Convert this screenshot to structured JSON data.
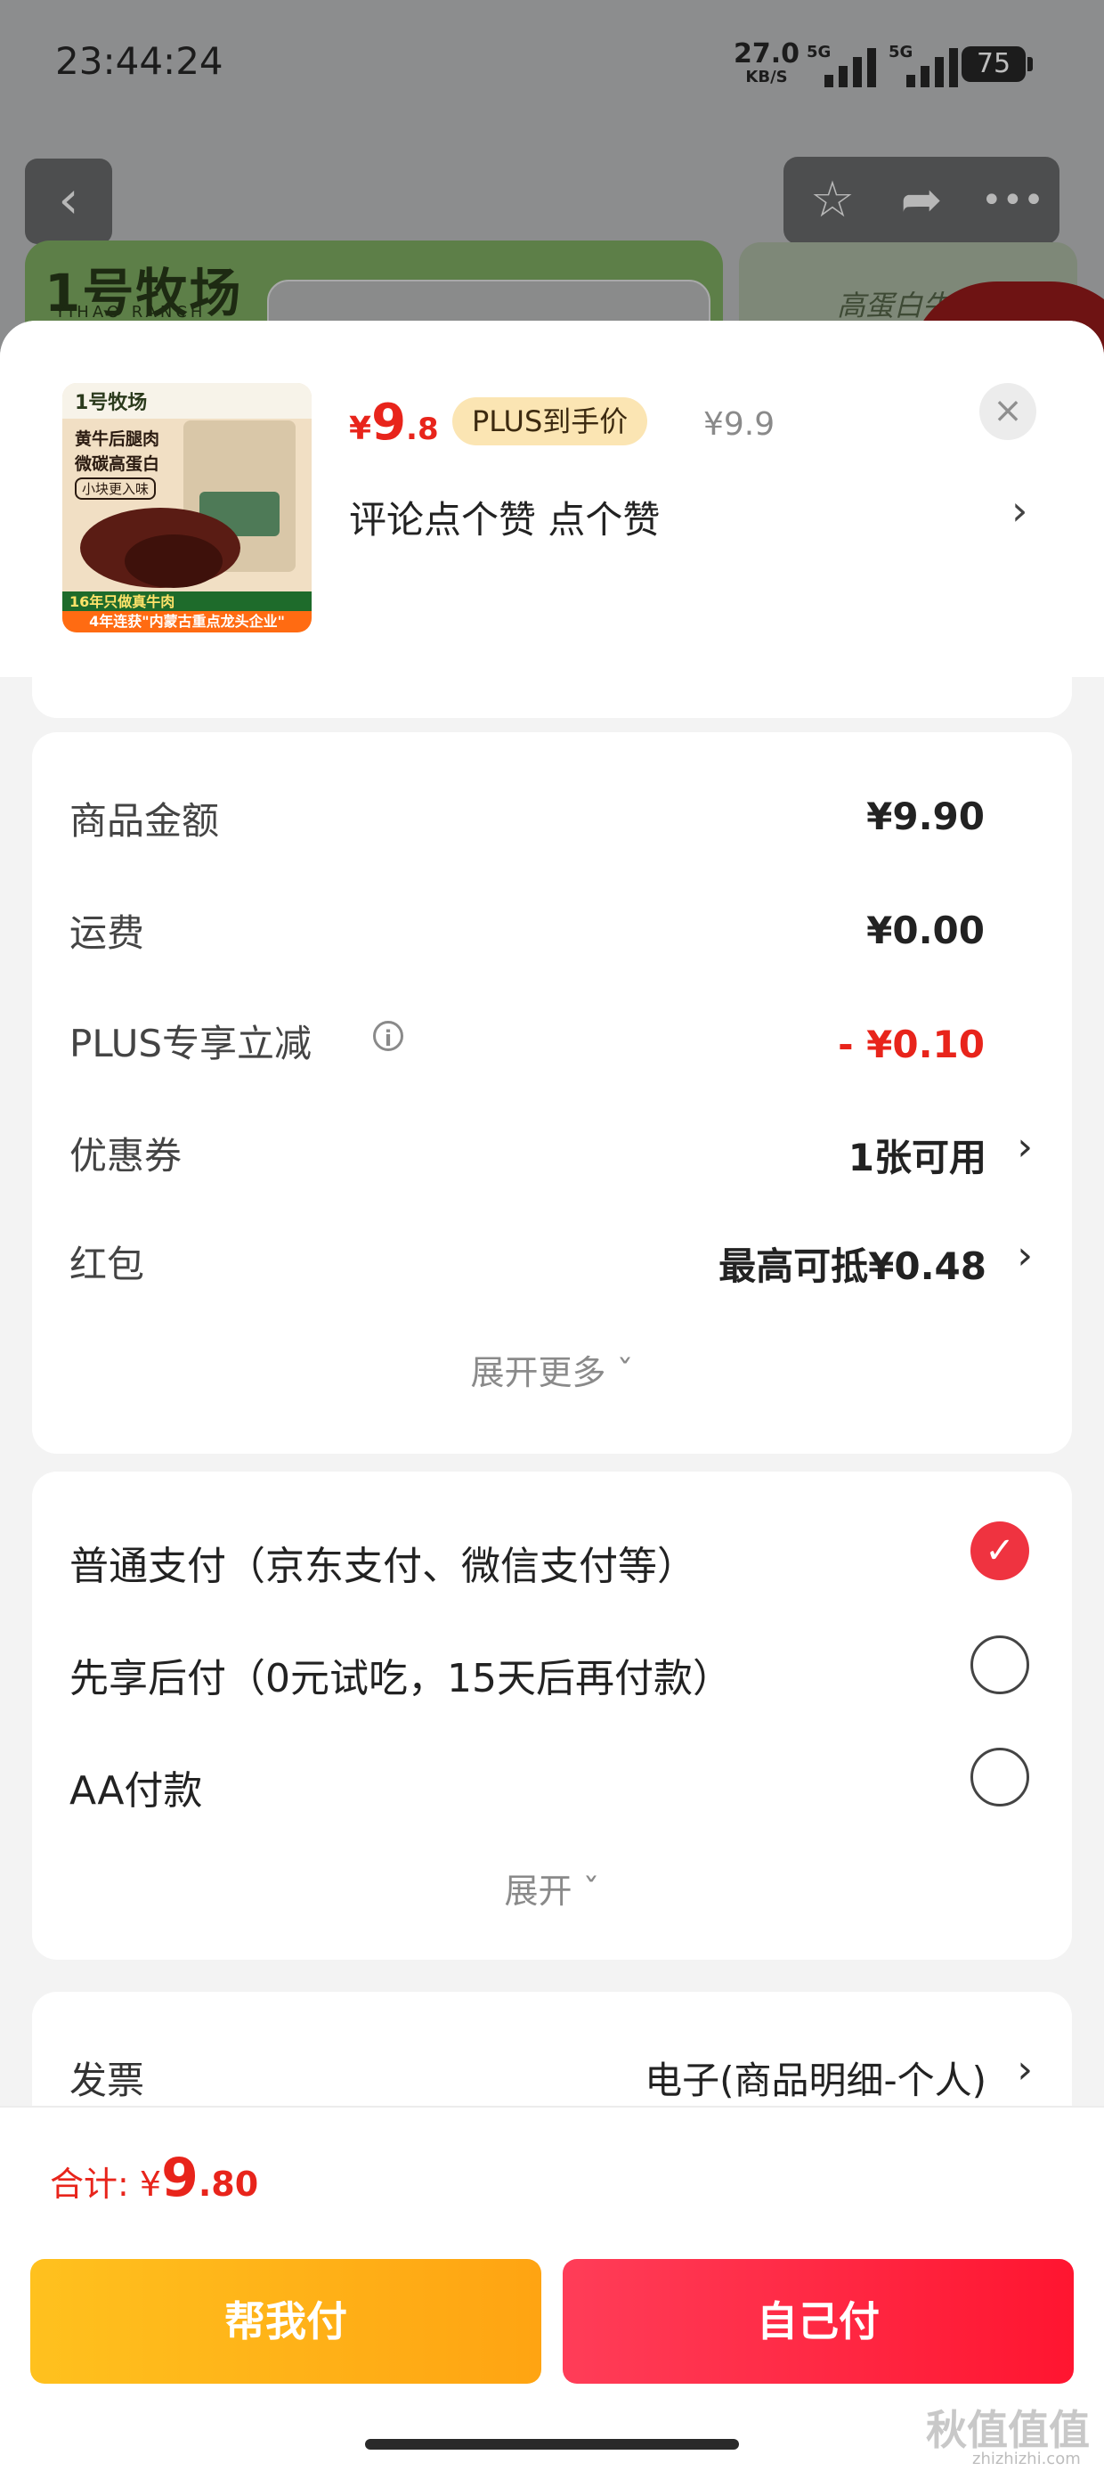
{
  "status_bar": {
    "time": "23:44:24",
    "net_speed": "27.0",
    "net_unit": "KB/S",
    "sim1": "5G",
    "sim2": "5G",
    "battery": "75"
  },
  "background_page": {
    "brand_logo": "1号牧场",
    "brand_logo_en": "YIHAO RANCH",
    "banner_text": "高蛋白牛"
  },
  "product": {
    "image_text": {
      "logo": "1号牧场",
      "line1": "黄牛后腿肉",
      "line2": "微碳高蛋白",
      "line3": "小块更入味",
      "bar1": "16年只做真牛肉",
      "bar2": "4年连获\"内蒙古重点龙头企业\""
    },
    "price_currency": "¥",
    "price_int": "9",
    "price_dec": ".8",
    "plus_tag": "PLUS到手价",
    "original_price": "¥9.9",
    "spec": "评论点个赞  点个赞",
    "close_icon": "close-icon",
    "spec_arrow": "›"
  },
  "cost_detail": {
    "rows": [
      {
        "label": "商品金额",
        "value": "¥9.90"
      },
      {
        "label": "运费",
        "value": "¥0.00"
      },
      {
        "label": "PLUS专享立减",
        "value": "- ¥0.10"
      },
      {
        "label": "优惠券",
        "value": "1张可用"
      },
      {
        "label": "红包",
        "value": "最高可抵¥0.48"
      }
    ],
    "expand_label": "展开更多 ˇ",
    "arrow": "›",
    "info_icon": "i"
  },
  "payment": {
    "options": [
      {
        "label": "普通支付（京东支付、微信支付等）",
        "selected": true
      },
      {
        "label": "先享后付（0元试吃，15天后再付款）",
        "selected": false
      },
      {
        "label": "AA付款",
        "selected": false
      }
    ],
    "expand_label": "展开 ˇ",
    "check_mark": "✓"
  },
  "invoice": {
    "label": "发票",
    "value": "电子(商品明细-个人)",
    "arrow": "›"
  },
  "footer": {
    "total_label": "合计: ¥",
    "total_int": "9",
    "total_dec": ".80",
    "help_pay": "帮我付",
    "self_pay": "自己付",
    "watermark": "秋值值值",
    "watermark_sub": "zhizhizhi.com"
  },
  "colors": {
    "accent_red": "#e8241b",
    "pay_red": "#ff1530",
    "help_yellow": "#ffb21a",
    "plus_tag_bg": "#fbe5b3"
  }
}
